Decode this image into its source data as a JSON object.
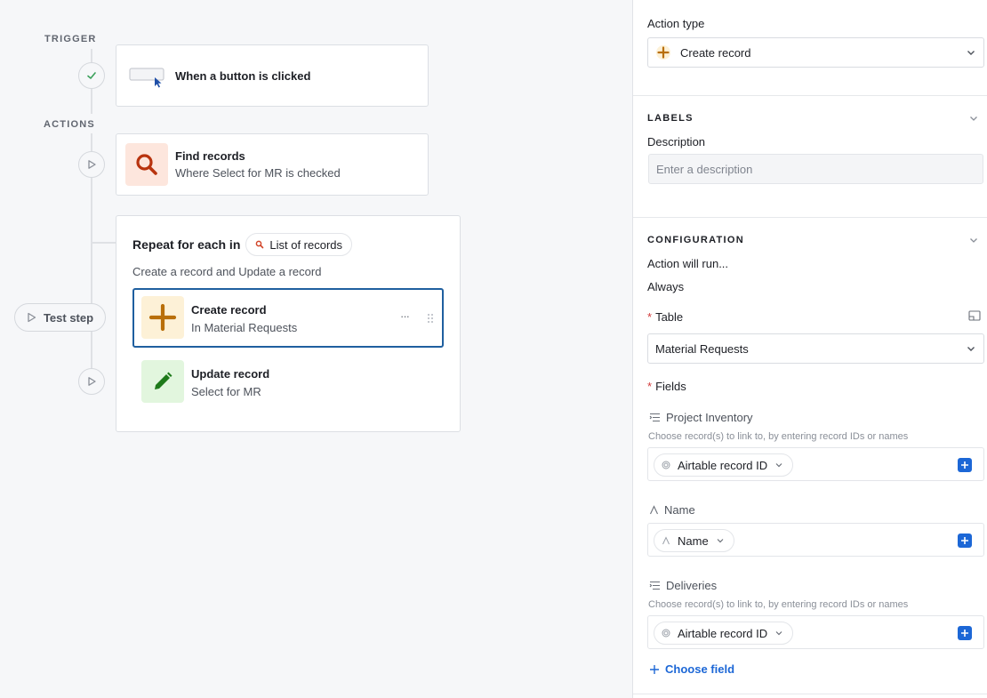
{
  "canvas": {
    "trigger_label": "TRIGGER",
    "actions_label": "ACTIONS",
    "trigger": {
      "title": "When a button is clicked"
    },
    "find": {
      "title": "Find records",
      "subtitle": "Where Select for MR is checked"
    },
    "repeat": {
      "title": "Repeat for each in",
      "pill_label": "List of records",
      "subtitle": "Create a record and Update a record"
    },
    "create": {
      "title": "Create record",
      "subtitle": "In Material Requests",
      "more": "···"
    },
    "update": {
      "title": "Update record",
      "subtitle": "Select for MR"
    },
    "test_step": "Test step"
  },
  "panel": {
    "action_type_label": "Action type",
    "action_type_value": "Create record",
    "labels_header": "LABELS",
    "description_label": "Description",
    "description_placeholder": "Enter a description",
    "config_header": "CONFIGURATION",
    "action_runs_label": "Action will run...",
    "action_runs_value": "Always",
    "table_label": "Table",
    "table_value": "Material Requests",
    "fields_label": "Fields",
    "required_marker": "*",
    "fields": [
      {
        "name": "Project Inventory",
        "hint": "Choose record(s) to link to, by entering record IDs or names",
        "chip": "Airtable record ID"
      },
      {
        "name": "Name",
        "hint": "",
        "chip": "Name"
      },
      {
        "name": "Deliveries",
        "hint": "Choose record(s) to link to, by entering record IDs or names",
        "chip": "Airtable record ID"
      }
    ],
    "choose_field": "Choose field"
  },
  "colors": {
    "accent_blue": "#1c67d6",
    "selected_border": "#1f5f9f",
    "find_icon_bg": "#fde6dd",
    "find_icon_fg": "#b8340f",
    "create_icon_bg": "#fdf1d7",
    "create_icon_fg": "#b96f0a",
    "update_icon_bg": "#e2f6de",
    "update_icon_fg": "#1e7a1a",
    "check_green": "#3aa05a"
  }
}
